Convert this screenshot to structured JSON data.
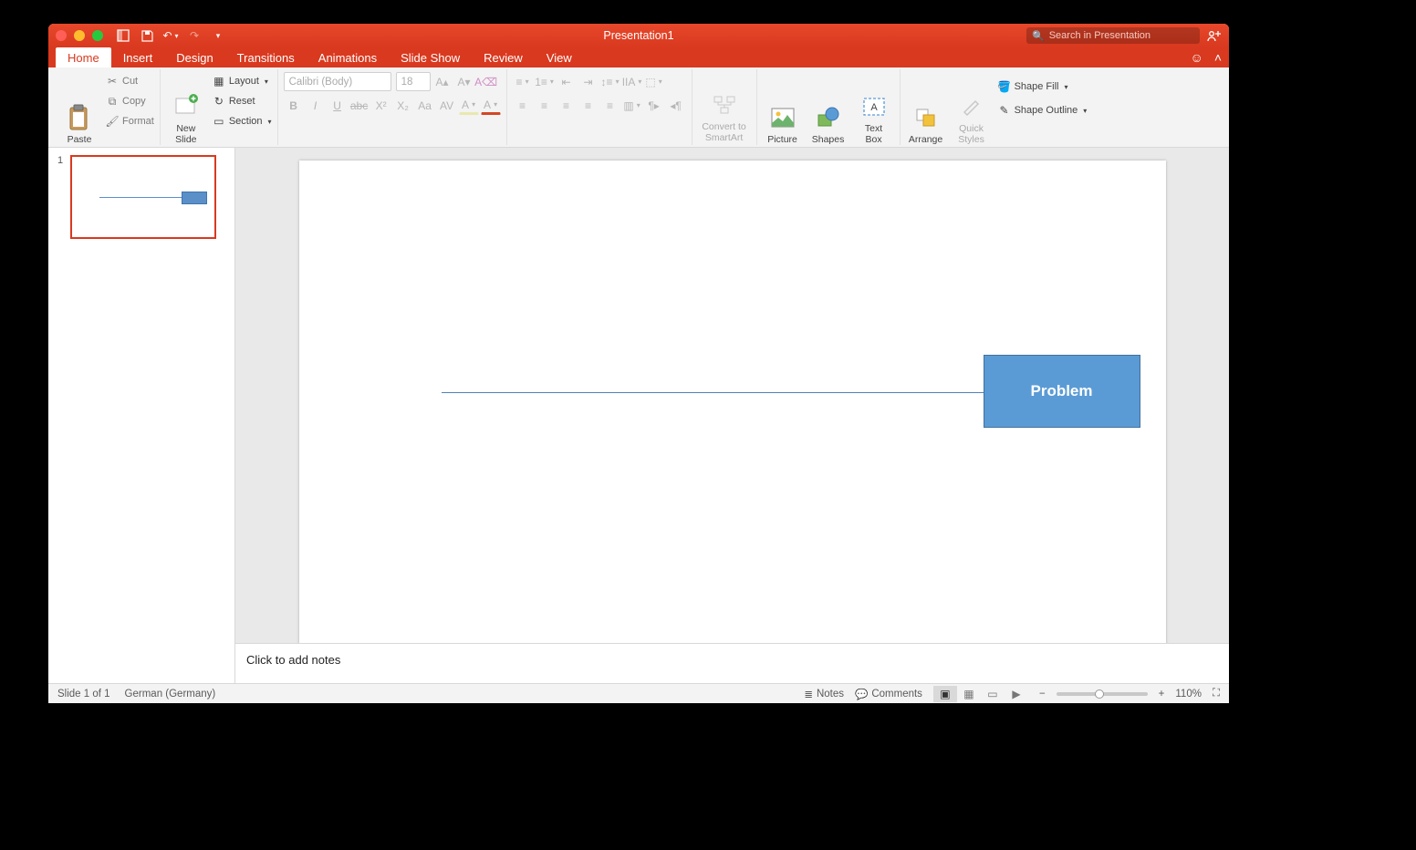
{
  "title": "Presentation1",
  "search_placeholder": "Search in Presentation",
  "tabs": [
    "Home",
    "Insert",
    "Design",
    "Transitions",
    "Animations",
    "Slide Show",
    "Review",
    "View"
  ],
  "active_tab": 0,
  "ribbon": {
    "paste": "Paste",
    "cut": "Cut",
    "copy": "Copy",
    "format": "Format",
    "new_slide": "New\nSlide",
    "layout": "Layout",
    "reset": "Reset",
    "section": "Section",
    "font_name": "Calibri (Body)",
    "font_size": "18",
    "convert": "Convert to\nSmartArt",
    "picture": "Picture",
    "shapes": "Shapes",
    "textbox": "Text\nBox",
    "arrange": "Arrange",
    "quick_styles": "Quick\nStyles",
    "shape_fill": "Shape Fill",
    "shape_outline": "Shape Outline"
  },
  "thumb_number": "1",
  "slide_box_text": "Problem",
  "notes_placeholder": "Click to add notes",
  "status": {
    "slide_info": "Slide 1 of 1",
    "language": "German (Germany)",
    "notes": "Notes",
    "comments": "Comments",
    "zoom": "110%"
  }
}
